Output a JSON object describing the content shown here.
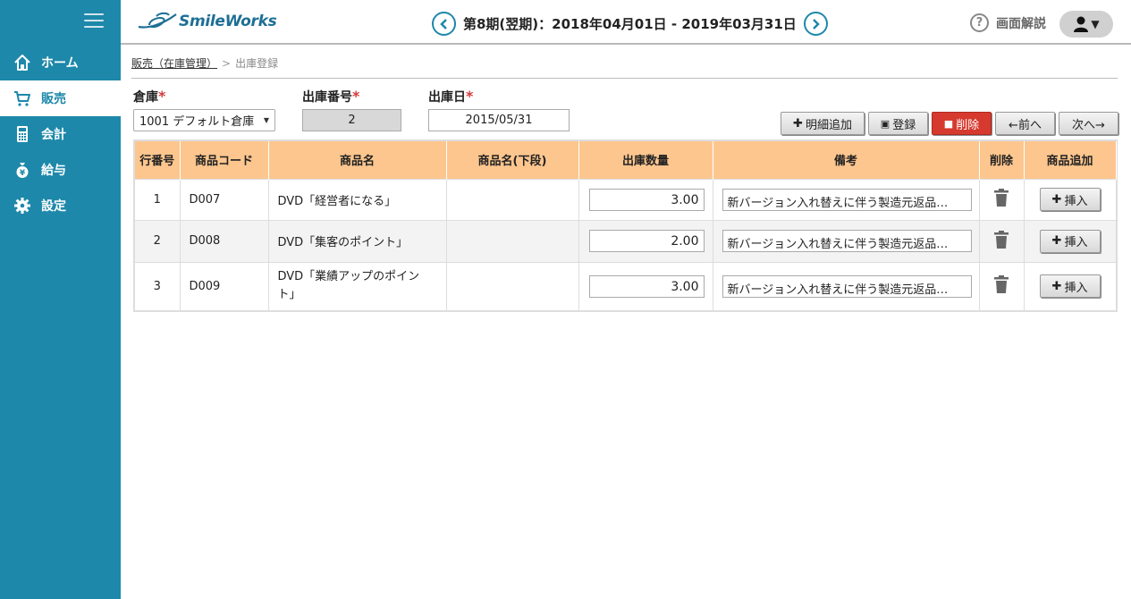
{
  "app": {
    "logo_text": "SmileWorks"
  },
  "header": {
    "period": "第8期(翌期)：2018年04月01日 - 2019年03月31日",
    "help_label": "画面解説"
  },
  "sidebar": {
    "items": [
      {
        "label": "ホーム",
        "icon": "home-icon"
      },
      {
        "label": "販売",
        "icon": "cart-icon",
        "active": true
      },
      {
        "label": "会計",
        "icon": "calculator-icon"
      },
      {
        "label": "給与",
        "icon": "money-bag-icon"
      },
      {
        "label": "設定",
        "icon": "gear-icon"
      }
    ]
  },
  "breadcrumb": {
    "parent": "販売（在庫管理）",
    "separator": ">",
    "current": "出庫登録"
  },
  "form": {
    "warehouse_label": "倉庫",
    "warehouse_value": "1001 デフォルト倉庫",
    "number_label": "出庫番号",
    "number_value": "2",
    "date_label": "出庫日",
    "date_value": "2015/05/31",
    "required_mark": "*"
  },
  "toolbar": {
    "add_detail": "明細追加",
    "register": "登録",
    "delete": "削除",
    "prev": "←前へ",
    "next": "次へ→"
  },
  "table": {
    "headers": [
      "行番号",
      "商品コード",
      "商品名",
      "商品名(下段)",
      "出庫数量",
      "備考",
      "削除",
      "商品追加"
    ],
    "rows": [
      {
        "no": "1",
        "code": "D007",
        "name": "DVD「経営者になる」",
        "name2": "",
        "qty": "3.00",
        "note": "新バージョン入れ替えに伴う製造元返品…"
      },
      {
        "no": "2",
        "code": "D008",
        "name": "DVD「集客のポイント」",
        "name2": "",
        "qty": "2.00",
        "note": "新バージョン入れ替えに伴う製造元返品…"
      },
      {
        "no": "3",
        "code": "D009",
        "name": "DVD「業績アップのポイント」",
        "name2": "",
        "qty": "3.00",
        "note": "新バージョン入れ替えに伴う製造元返品…"
      }
    ],
    "insert_label": "挿入"
  },
  "colors": {
    "sidebar": "#1d88aa",
    "header_row": "#fdc68e",
    "danger": "#d63a2e"
  }
}
